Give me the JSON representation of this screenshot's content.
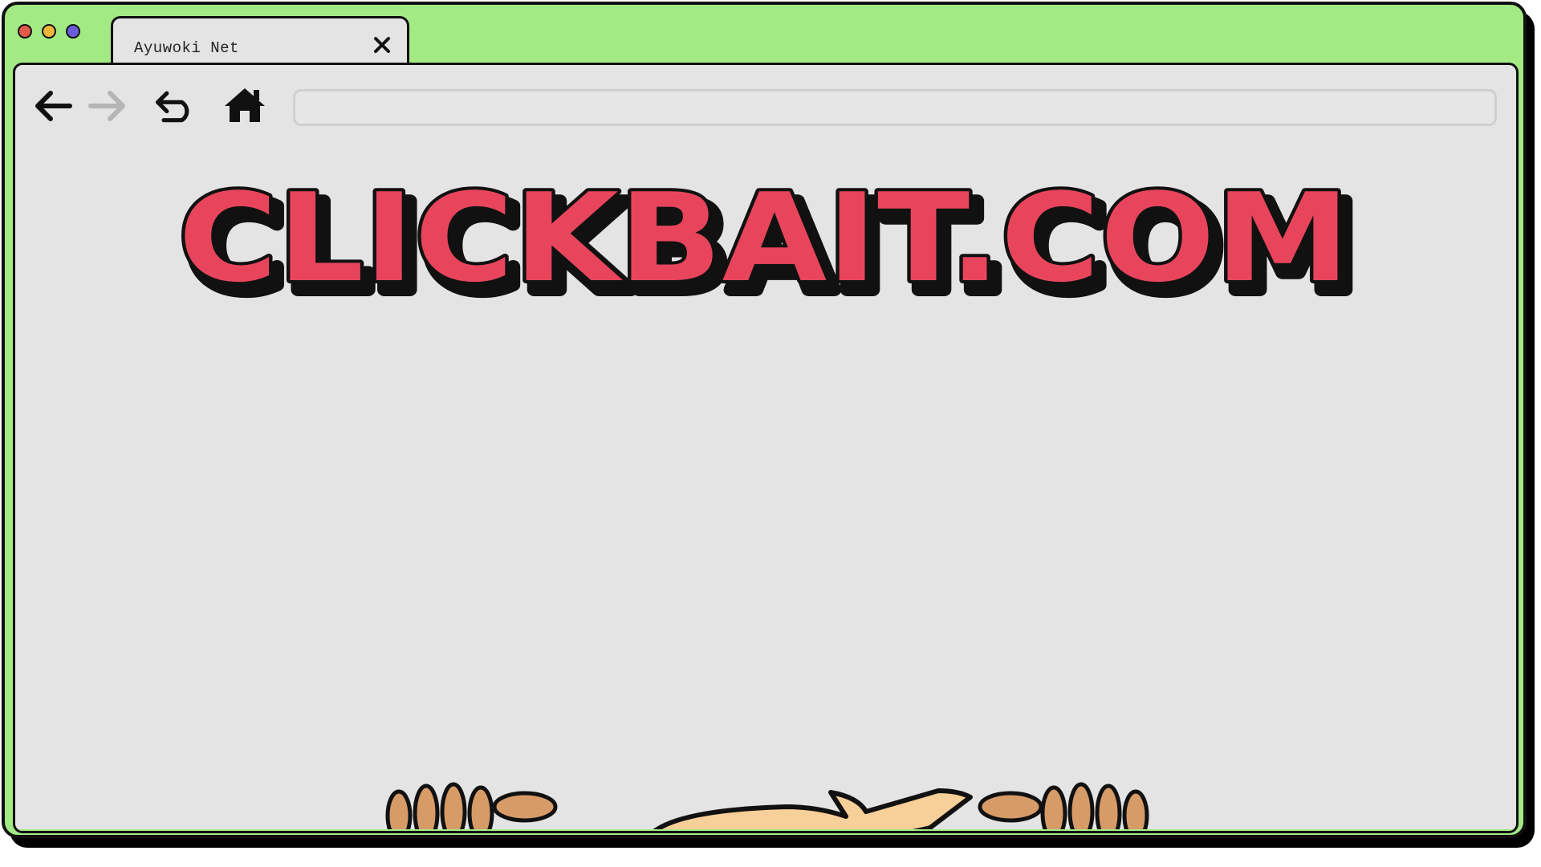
{
  "tab": {
    "title": "Ayuwoki Net",
    "close_icon": "close-icon"
  },
  "window_controls": {
    "colors": [
      "#e25a4a",
      "#f0b43a",
      "#6a5cd8"
    ]
  },
  "nav": {
    "back_icon": "arrow-left-icon",
    "forward_icon": "arrow-right-icon",
    "reload_icon": "undo-icon",
    "home_icon": "home-icon",
    "forward_enabled": false
  },
  "address_bar": {
    "value": "",
    "placeholder": ""
  },
  "page": {
    "logo_text": "CLICKBAIT.COM",
    "logo_color": "#e8455c",
    "peeker_icon": "peeking-hands-icon"
  },
  "colors": {
    "frame": "#a3ea85",
    "content_bg": "#e4e4e4",
    "outline": "#111111"
  }
}
